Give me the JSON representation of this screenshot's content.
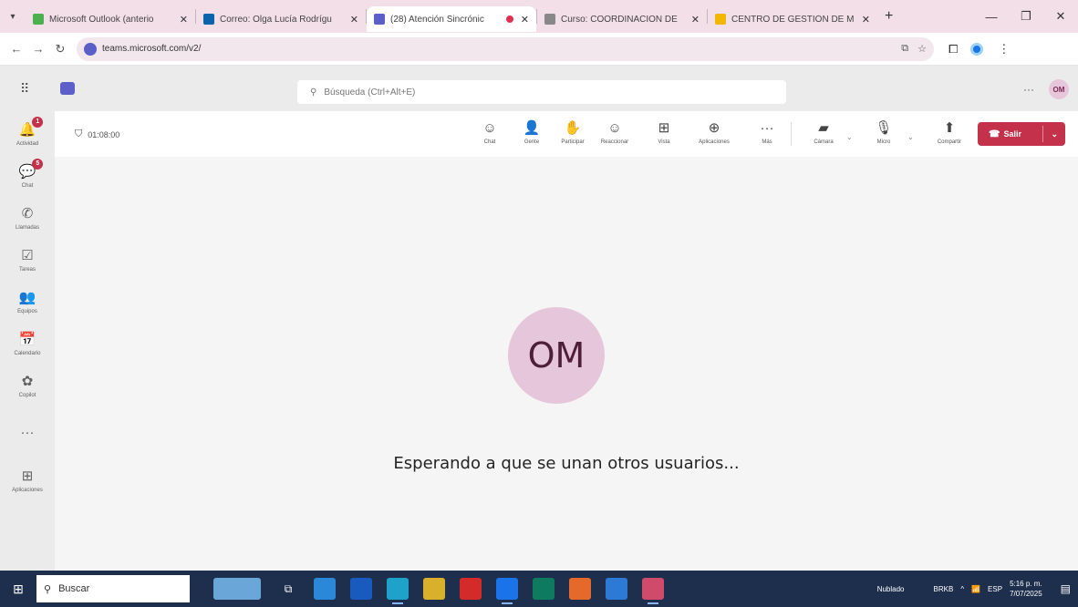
{
  "browser": {
    "tabs": [
      {
        "title": "Microsoft Outlook (anterio",
        "favicon_color": "#4caf50",
        "active": false
      },
      {
        "title": "Correo: Olga Lucía Rodrígu",
        "favicon_color": "#0a64ad",
        "active": false
      },
      {
        "title": "(28) Atención Sincrónic",
        "favicon_color": "#5b5fc7",
        "active": true,
        "recording": true
      },
      {
        "title": "Curso: COORDINACION DE",
        "favicon_color": "#888888",
        "active": false
      },
      {
        "title": "CENTRO DE GESTIÓN DE M",
        "favicon_color": "#f2b705",
        "active": false
      }
    ],
    "new_tab": "+",
    "url": "teams.microsoft.com/v2/"
  },
  "teams": {
    "search_placeholder": "Búsqueda (Ctrl+Alt+E)",
    "more": "···",
    "avatar_initials": "OM",
    "rail": [
      {
        "label": "Actividad",
        "icon": "bell-icon",
        "glyph": "🔔",
        "badge": "1"
      },
      {
        "label": "Chat",
        "icon": "chat-icon",
        "glyph": "💬",
        "badge": "5"
      },
      {
        "label": "Llamadas",
        "icon": "phone-icon",
        "glyph": "✆"
      },
      {
        "label": "Tareas",
        "icon": "tasks-icon",
        "glyph": "☑"
      },
      {
        "label": "Equipos",
        "icon": "teams-icon",
        "glyph": "👥"
      },
      {
        "label": "Calendario",
        "icon": "calendar-icon",
        "glyph": "📅"
      },
      {
        "label": "Copilot",
        "icon": "copilot-icon",
        "glyph": "✿"
      },
      {
        "label": "",
        "icon": "more-apps-icon",
        "glyph": "···"
      },
      {
        "label": "Aplicaciones",
        "icon": "apps-icon",
        "glyph": "⊞"
      }
    ]
  },
  "meeting": {
    "timer": "01:08:00",
    "toolbar": [
      {
        "label": "Chat",
        "icon": "chat-icon",
        "glyph": "☺"
      },
      {
        "label": "Gente",
        "icon": "people-icon",
        "glyph": "👤"
      },
      {
        "label": "Participar",
        "icon": "raise-hand-icon",
        "glyph": "✋"
      },
      {
        "label": "Reaccionar",
        "icon": "react-icon",
        "glyph": "☺"
      },
      {
        "label": "Vista",
        "icon": "view-icon",
        "glyph": "⊞"
      },
      {
        "label": "Aplicaciones",
        "icon": "apps-icon",
        "glyph": "⊕"
      },
      {
        "label": "Más",
        "icon": "more-icon",
        "glyph": "···"
      },
      {
        "label": "Cámara",
        "icon": "camera-off-icon",
        "glyph": "▰"
      },
      {
        "label": "Micro",
        "icon": "mic-off-icon",
        "glyph": "🎙"
      },
      {
        "label": "Compartir",
        "icon": "share-icon",
        "glyph": "⬆"
      }
    ],
    "leave_label": "Salir",
    "avatar_initials": "OM",
    "waiting_text": "Esperando a que se unan otros usuarios..."
  },
  "taskbar": {
    "search_placeholder": "Buscar",
    "weather": "Nublado",
    "stock": "BRKB",
    "lang": "ESP",
    "time": "5:16 p. m.",
    "date": "7/07/2025"
  },
  "colors": {
    "leave": "#c4314b",
    "teams_purple": "#5b5fc7",
    "avatar_bg": "#e6c6da"
  }
}
